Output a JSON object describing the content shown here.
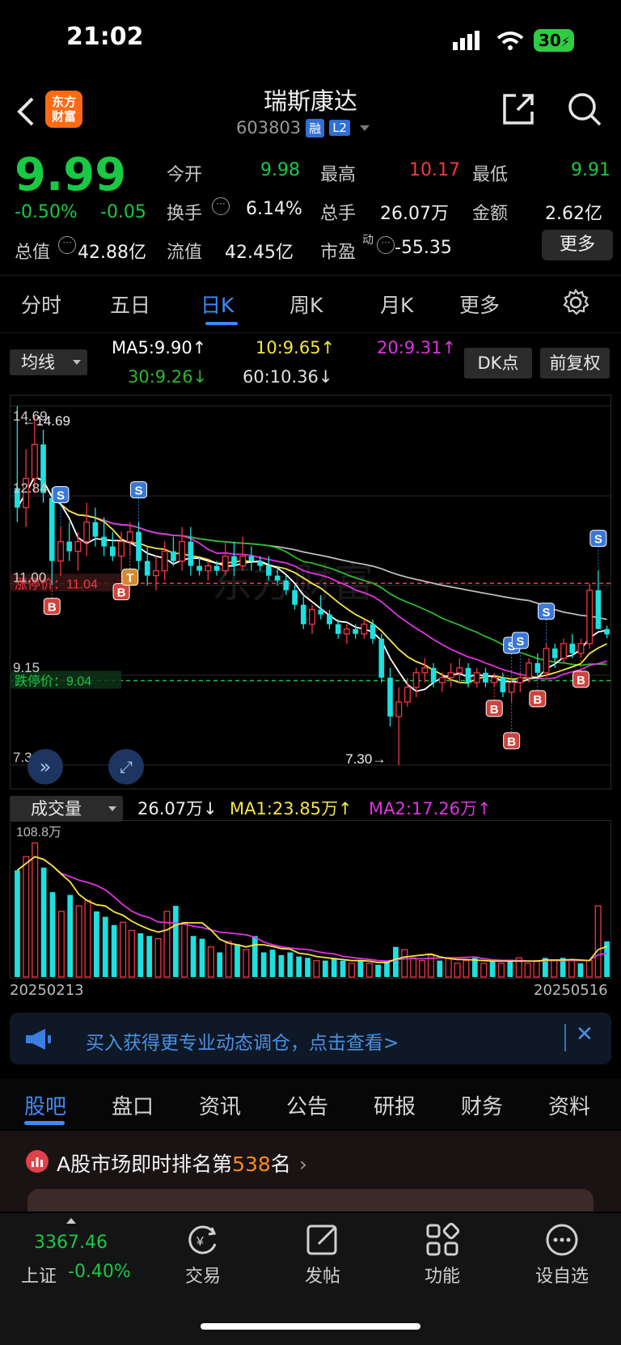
{
  "status_bar": {
    "time": "21:02",
    "battery": "30"
  },
  "header": {
    "stock_name": "瑞斯康达",
    "stock_code": "603803",
    "tag1": "融",
    "tag2": "L2",
    "logo_line1": "东方",
    "logo_line2": "财富"
  },
  "quote": {
    "price": "9.99",
    "change_pct": "-0.50%",
    "change": "-0.05",
    "open_label": "今开",
    "open": "9.98",
    "high_label": "最高",
    "high": "10.17",
    "low_label": "最低",
    "low": "9.91",
    "turnover_label": "换手",
    "turnover": "6.14%",
    "volume_label": "总手",
    "volume": "26.07万",
    "amount_label": "金额",
    "amount": "2.62亿",
    "mktcap_label": "总值",
    "mktcap": "42.88亿",
    "float_label": "流值",
    "float_cap": "42.45亿",
    "pe_label": "市盈",
    "pe_sup": "动",
    "pe": "-55.35",
    "more_label": "更多"
  },
  "period_tabs": [
    "分时",
    "五日",
    "日K",
    "周K",
    "月K",
    "更多"
  ],
  "indicators": {
    "ma_select": "均线",
    "ma5": "MA5:9.90↑",
    "ma10": "10:9.65↑",
    "ma20": "20:9.31↑",
    "ma30": "30:9.26↓",
    "ma60": "60:10.36↓",
    "dk_label": "DK点",
    "fq_label": "前复权",
    "colors": {
      "ma5": "#ffffff",
      "ma10": "#f5e642",
      "ma20": "#e033e0",
      "ma30": "#2db82d",
      "ma60": "#bdbdbd"
    }
  },
  "chart_data": [
    {
      "type": "candlestick",
      "title": "",
      "y_labels": [
        "14.69",
        "12.84",
        "11.00",
        "9.15",
        "7.30"
      ],
      "ylim": [
        7.3,
        14.69
      ],
      "max_marker": "14.69",
      "min_marker": "7.30",
      "limit_up_label": "涨停价：11.04",
      "limit_down_label": "跌停价：9.04",
      "limit_up": 11.04,
      "limit_down": 9.04,
      "watermark": "东方财富",
      "candles": [
        [
          13.0,
          14.69,
          12.3,
          12.6
        ],
        [
          12.6,
          13.8,
          12.2,
          13.2
        ],
        [
          13.2,
          14.5,
          12.9,
          13.9
        ],
        [
          13.9,
          14.2,
          12.7,
          12.9
        ],
        [
          12.8,
          13.0,
          11.0,
          11.5
        ],
        [
          11.5,
          12.2,
          11.2,
          11.9
        ],
        [
          11.9,
          12.3,
          11.5,
          11.7
        ],
        [
          11.7,
          12.1,
          11.3,
          11.9
        ],
        [
          11.9,
          12.7,
          11.6,
          12.3
        ],
        [
          12.3,
          12.6,
          11.8,
          12.0
        ],
        [
          12.0,
          12.4,
          11.6,
          11.8
        ],
        [
          11.8,
          12.1,
          11.5,
          11.6
        ],
        [
          11.6,
          12.1,
          11.3,
          11.9
        ],
        [
          11.9,
          12.3,
          11.6,
          12.1
        ],
        [
          12.1,
          12.3,
          11.3,
          11.5
        ],
        [
          11.5,
          11.8,
          11.0,
          11.2
        ],
        [
          11.2,
          11.6,
          10.9,
          11.3
        ],
        [
          11.3,
          11.9,
          11.1,
          11.7
        ],
        [
          11.7,
          12.0,
          11.4,
          11.5
        ],
        [
          11.5,
          12.2,
          11.3,
          11.9
        ],
        [
          11.9,
          12.2,
          11.2,
          11.4
        ],
        [
          11.4,
          11.6,
          11.2,
          11.3
        ],
        [
          11.3,
          11.5,
          11.1,
          11.4
        ],
        [
          11.4,
          11.5,
          11.2,
          11.3
        ],
        [
          11.3,
          11.9,
          11.2,
          11.6
        ],
        [
          11.6,
          11.9,
          11.2,
          11.4
        ],
        [
          11.4,
          12.0,
          11.3,
          11.6
        ],
        [
          11.6,
          11.8,
          11.3,
          11.5
        ],
        [
          11.5,
          11.6,
          11.3,
          11.4
        ],
        [
          11.4,
          11.6,
          11.1,
          11.2
        ],
        [
          11.2,
          11.4,
          11.0,
          11.1
        ],
        [
          11.1,
          11.2,
          10.8,
          10.9
        ],
        [
          10.9,
          11.0,
          10.5,
          10.6
        ],
        [
          10.6,
          10.8,
          10.1,
          10.2
        ],
        [
          10.2,
          10.6,
          10.0,
          10.5
        ],
        [
          10.5,
          10.8,
          10.3,
          10.4
        ],
        [
          10.4,
          10.5,
          10.1,
          10.2
        ],
        [
          10.2,
          10.3,
          9.9,
          10.0
        ],
        [
          10.0,
          10.2,
          9.8,
          10.1
        ],
        [
          10.1,
          10.2,
          9.9,
          10.0
        ],
        [
          10.0,
          10.3,
          9.9,
          10.2
        ],
        [
          10.2,
          10.3,
          9.8,
          9.9
        ],
        [
          9.9,
          10.0,
          9.0,
          9.1
        ],
        [
          9.1,
          9.3,
          8.1,
          8.3
        ],
        [
          8.3,
          8.9,
          7.3,
          8.6
        ],
        [
          8.6,
          9.1,
          8.5,
          8.9
        ],
        [
          8.9,
          9.3,
          8.7,
          9.2
        ],
        [
          9.2,
          9.5,
          9.0,
          9.3
        ],
        [
          9.3,
          9.4,
          8.9,
          9.0
        ],
        [
          9.0,
          9.2,
          8.8,
          9.1
        ],
        [
          9.1,
          9.4,
          8.9,
          9.2
        ],
        [
          9.2,
          9.5,
          9.0,
          9.3
        ],
        [
          9.3,
          9.4,
          8.9,
          9.0
        ],
        [
          9.0,
          9.3,
          8.9,
          9.2
        ],
        [
          9.2,
          9.3,
          8.9,
          9.0
        ],
        [
          9.0,
          9.2,
          8.9,
          9.1
        ],
        [
          9.1,
          9.2,
          8.7,
          8.8
        ],
        [
          8.8,
          9.1,
          8.6,
          9.0
        ],
        [
          9.0,
          9.2,
          8.8,
          9.1
        ],
        [
          9.1,
          9.5,
          9.0,
          9.4
        ],
        [
          9.4,
          9.6,
          9.1,
          9.2
        ],
        [
          9.2,
          9.8,
          9.1,
          9.7
        ],
        [
          9.7,
          9.8,
          9.3,
          9.5
        ],
        [
          9.5,
          9.9,
          9.4,
          9.8
        ],
        [
          9.8,
          10.0,
          9.5,
          9.6
        ],
        [
          9.6,
          9.9,
          9.5,
          9.8
        ],
        [
          9.8,
          11.04,
          9.7,
          10.9
        ],
        [
          10.9,
          11.3,
          10.1,
          10.1
        ],
        [
          10.1,
          10.17,
          9.91,
          9.99
        ]
      ],
      "signals": [
        {
          "label": "S",
          "index": 5
        },
        {
          "label": "S",
          "index": 14
        },
        {
          "label": "B",
          "index": 4
        },
        {
          "label": "B",
          "index": 12
        },
        {
          "label": "T",
          "index": 13
        },
        {
          "label": "S",
          "index": 57
        },
        {
          "label": "S",
          "index": 58
        },
        {
          "label": "S",
          "index": 61
        },
        {
          "label": "S",
          "index": 67
        },
        {
          "label": "B",
          "index": 55
        },
        {
          "label": "B",
          "index": 57
        },
        {
          "label": "B",
          "index": 60
        },
        {
          "label": "B",
          "index": 65
        }
      ]
    },
    {
      "type": "bar",
      "title": "",
      "select_label": "成交量",
      "current": "26.07万↓",
      "ma1": "MA1:23.85万↑",
      "ma2": "MA2:17.26万↑",
      "max_label": "108.8万",
      "ylim": [
        0,
        108.8
      ],
      "start_date": "20250213",
      "end_date": "20250516",
      "values": [
        78,
        88,
        98,
        80,
        62,
        48,
        60,
        52,
        56,
        48,
        44,
        38,
        40,
        34,
        32,
        30,
        28,
        48,
        52,
        40,
        30,
        28,
        22,
        18,
        26,
        24,
        20,
        30,
        18,
        20,
        16,
        18,
        15,
        14,
        12,
        12,
        14,
        12,
        10,
        12,
        10,
        9,
        12,
        22,
        20,
        14,
        12,
        16,
        12,
        14,
        10,
        12,
        14,
        10,
        12,
        10,
        12,
        14,
        10,
        12,
        14,
        12,
        14,
        12,
        10,
        12,
        52,
        26
      ]
    }
  ],
  "banner": {
    "text": "买入获得更专业动态调仓，点击查看>"
  },
  "info_tabs": [
    "股吧",
    "盘口",
    "资讯",
    "公告",
    "研报",
    "财务",
    "资料"
  ],
  "rank": {
    "prefix": "A股市场即时排名第",
    "number": "538",
    "suffix": "名"
  },
  "bottom_nav": {
    "index_value": "3367.46",
    "index_name": "上证",
    "index_pct": "-0.40%",
    "trade": "交易",
    "post": "发帖",
    "function": "功能",
    "watchlist": "设自选"
  }
}
